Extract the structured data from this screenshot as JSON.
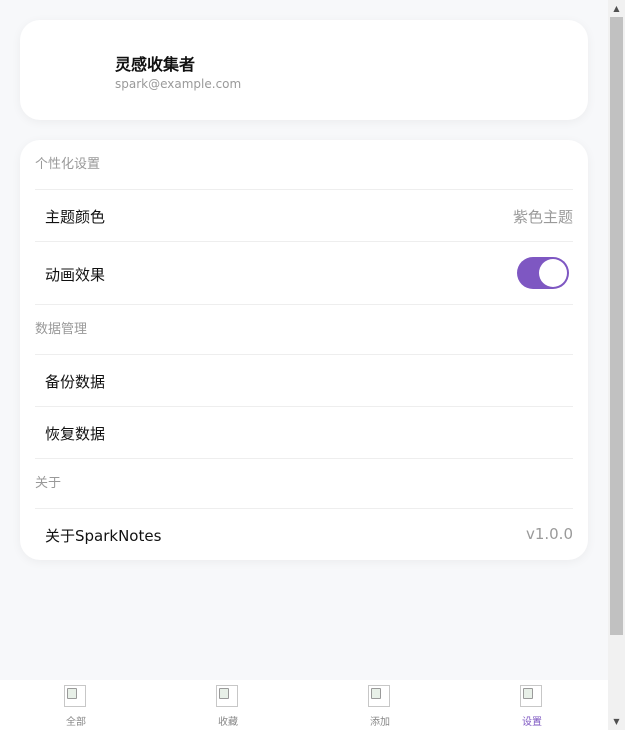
{
  "profile": {
    "name": "灵感收集者",
    "email": "spark@example.com"
  },
  "sections": {
    "personalization": {
      "title": "个性化设置",
      "theme_label": "主题颜色",
      "theme_value": "紫色主题",
      "animation_label": "动画效果",
      "animation_enabled": true
    },
    "data_management": {
      "title": "数据管理",
      "backup_label": "备份数据",
      "restore_label": "恢复数据"
    },
    "about": {
      "title": "关于",
      "about_label": "关于SparkNotes",
      "version": "v1.0.0"
    }
  },
  "tabbar": {
    "tabs": [
      {
        "label": "全部",
        "icon": "image-placeholder-icon"
      },
      {
        "label": "收藏",
        "icon": "image-placeholder-icon"
      },
      {
        "label": "添加",
        "icon": "image-placeholder-icon"
      },
      {
        "label": "设置",
        "icon": "image-placeholder-icon"
      }
    ],
    "active_index": 3
  },
  "colors": {
    "accent": "#7e57c2",
    "background": "#f7f8fa",
    "muted_text": "#9a9a9a"
  }
}
